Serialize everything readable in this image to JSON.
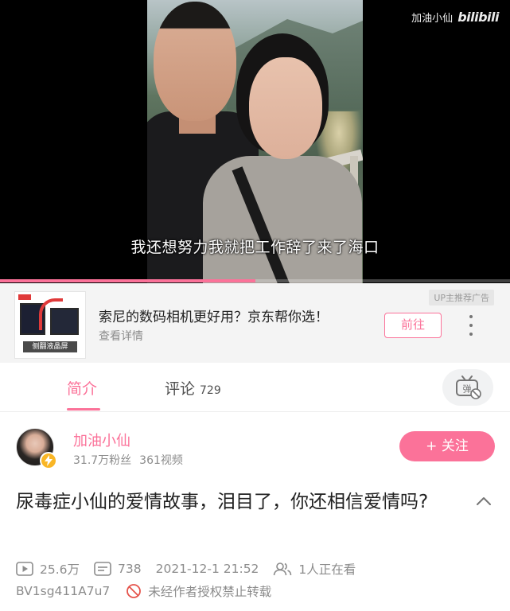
{
  "player": {
    "subtitle": "我还想努力我就把工作辞了来了海口",
    "watermark_text": "加油小仙",
    "watermark_logo": "bilibili",
    "progress_fraction": 0.5
  },
  "ad": {
    "title": "索尼的数码相机更好用？京东帮你选！",
    "subtitle": "查看详情",
    "tag": "UP主推荐广告",
    "button": "前往",
    "image_caption": "侧翻液晶屏"
  },
  "tabs": {
    "intro_label": "简介",
    "comments_label": "评论",
    "comments_count": "729"
  },
  "uploader": {
    "name": "加油小仙",
    "fans": "31.7万粉丝",
    "videos": "361视频",
    "follow_label": "+ 关注"
  },
  "video": {
    "title": "尿毒症小仙的爱情故事，泪目了，你还相信爱情吗?",
    "plays": "25.6万",
    "danmaku": "738",
    "publish_time": "2021-12-1 21:52",
    "watching": "1人正在看",
    "bvid": "BV1sg411A7u7",
    "copyright": "未经作者授权禁止转载"
  },
  "colors": {
    "accent": "#fb7299",
    "meta_gray": "#8c8c8c",
    "verify_badge": "#f9b626"
  }
}
